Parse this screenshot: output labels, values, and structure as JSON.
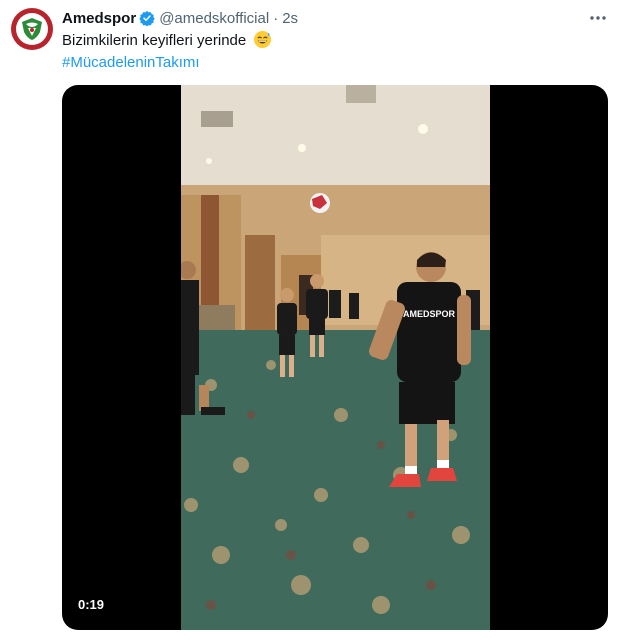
{
  "tweet": {
    "display_name": "Amedspor",
    "handle": "@amedskofficial",
    "separator": "·",
    "time": "2s",
    "text": "Bizimkilerin keyifleri yerinde",
    "emoji": "grinning-sweat-emoji",
    "hashtag": "#MücadeleninTakımı"
  },
  "video": {
    "duration": "0:19",
    "jersey_text": "AMEDSPOR"
  },
  "colors": {
    "link": "#1d9bf0",
    "verified": "#1d9bf0",
    "secondary_text": "#536471",
    "avatar_red": "#b8242c",
    "avatar_green": "#2e8b3a"
  },
  "icons": [
    "verified-badge-icon",
    "more-options-icon"
  ]
}
